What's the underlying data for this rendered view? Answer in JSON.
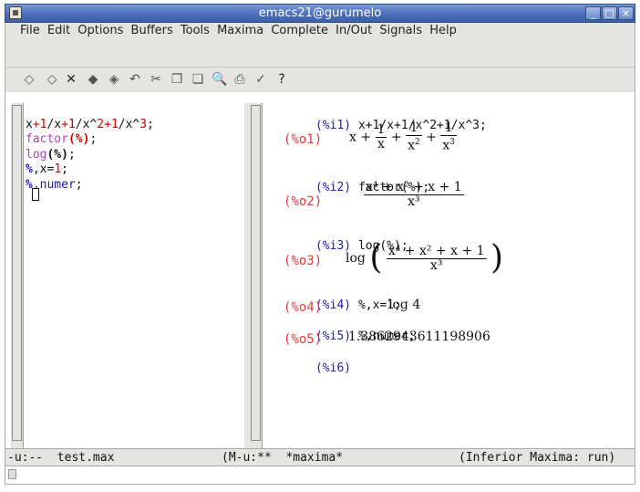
{
  "window": {
    "title": "emacs21@gurumelo",
    "controls": [
      "_",
      "□",
      "×"
    ]
  },
  "menu": [
    "File",
    "Edit",
    "Options",
    "Buffers",
    "Tools",
    "Maxima",
    "Complete",
    "In/Out",
    "Signals",
    "Help"
  ],
  "toolbar_icons": [
    "open-file-icon",
    "open-folder-icon",
    "close-icon",
    "save-icon",
    "save-as-icon",
    "undo-icon",
    "cut-icon",
    "copy-icon",
    "paste-icon",
    "search-icon",
    "print-icon",
    "spellcheck-icon",
    "help-icon"
  ],
  "toolbar_glyphs": [
    "◇",
    "◇",
    "✕",
    "◆",
    "◈",
    "↶",
    "✂",
    "❐",
    "❏",
    "🔍",
    "⎙",
    "✓",
    "?"
  ],
  "left_pane": {
    "lines": [
      [
        "x",
        "+",
        "1",
        "/x",
        "+",
        "1",
        "/x^",
        "2",
        "+",
        "1",
        "/x^",
        "3",
        ";"
      ],
      [
        "factor",
        "(%)",
        ";"
      ],
      [
        "log",
        "(%)",
        ";"
      ],
      [
        "%",
        ",x=",
        "1",
        ";"
      ],
      [
        "%",
        ",numer",
        ";"
      ]
    ]
  },
  "right_pane": {
    "i1_label": "(%i1)",
    "i1_text": "x+1/x+1/x^2+1/x^3;",
    "o1_label": "(%o1)",
    "o1_terms": [
      "x +",
      "1",
      "x",
      "+",
      "1",
      "x",
      "2",
      "+",
      "1",
      "x",
      "3"
    ],
    "i2_label": "(%i2)",
    "i2_text": "factor(%);",
    "o2_label": "(%o2)",
    "o2_num": "x⁴ + x² + x + 1",
    "o2_den": "x³",
    "i3_label": "(%i3)",
    "i3_text": "log(%);",
    "o3_label": "(%o3)",
    "o3_log": "log",
    "o3_num": "x⁴ + x² + x + 1",
    "o3_den": "x³",
    "i4_label": "(%i4)",
    "i4_text": "%,x=1;",
    "o4_label": "(%o4)",
    "o4_value": "log 4",
    "i5_label": "(%i5)",
    "i5_text": "%,numer;",
    "o5_label": "(%o5)",
    "o5_value": "1.3862943611198906",
    "i6_label": "(%i6)"
  },
  "modeline": {
    "left": "-u:--  test.max",
    "right_buffer": "(M-u:**  *maxima*",
    "mode": "(Inferior Maxima: run)"
  }
}
